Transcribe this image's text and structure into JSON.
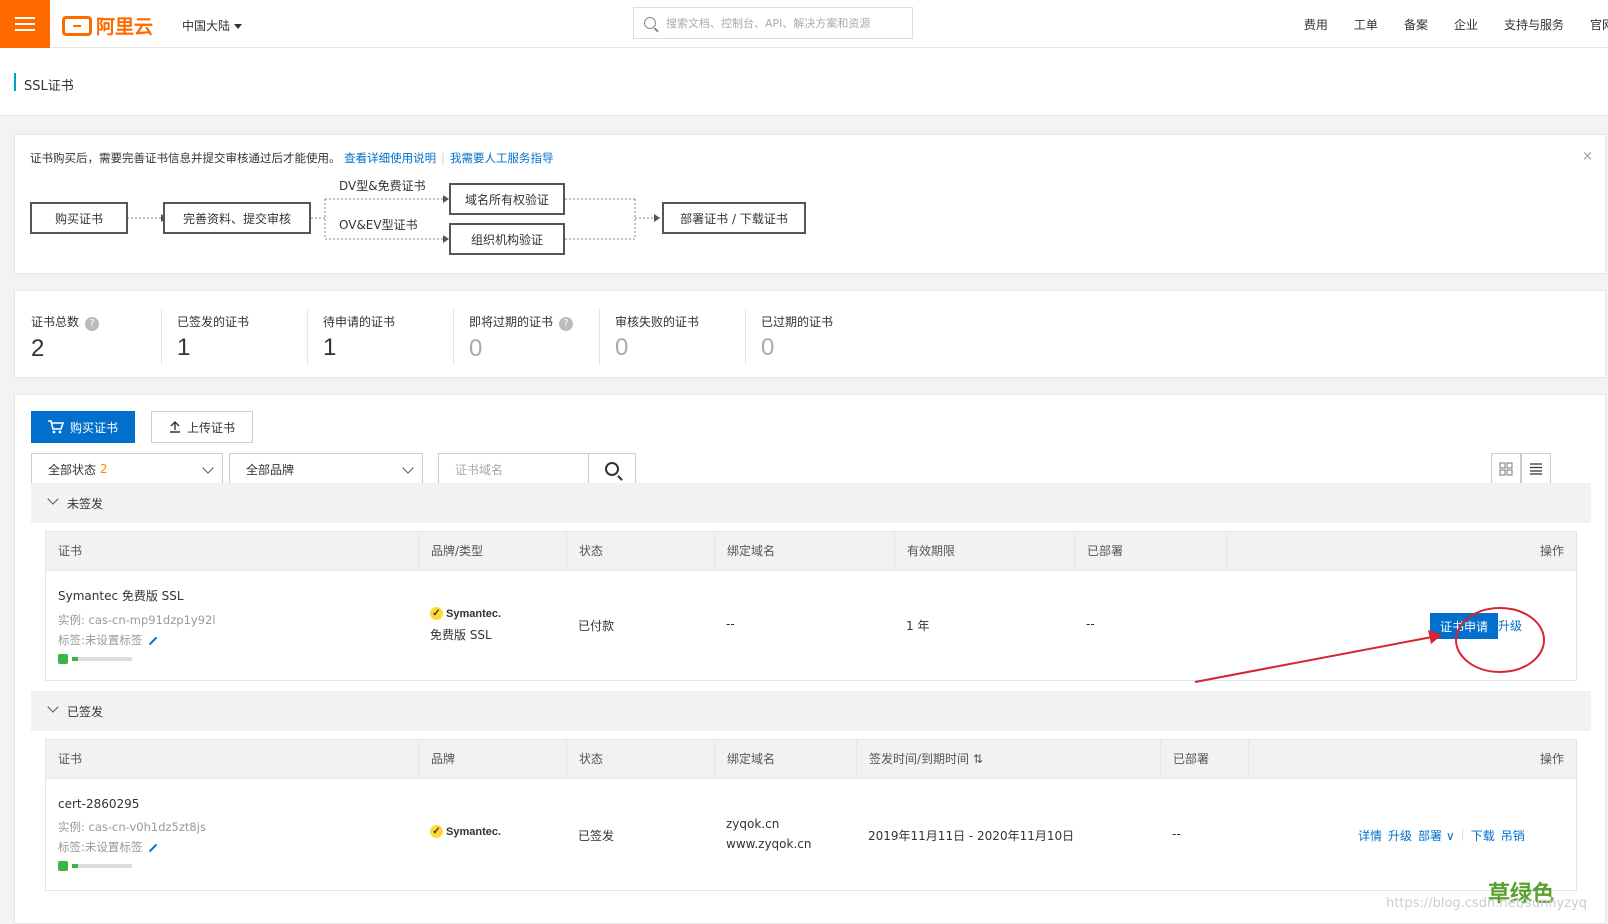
{
  "header": {
    "logo_text": "阿里云",
    "region": "中国大陆",
    "search_placeholder": "搜索文档、控制台、API、解决方案和资源",
    "nav": [
      "费用",
      "工单",
      "备案",
      "企业",
      "支持与服务",
      "官网"
    ],
    "accent": "#ff6a00"
  },
  "page": {
    "title": "SSL证书"
  },
  "notice": {
    "text": "证书购买后，需要完善证书信息并提交审核通过后才能使用。",
    "link1": "查看详细使用说明",
    "link2": "我需要人工服务指导",
    "close": "×",
    "flow": {
      "step_buy": "购买证书",
      "step_submit": "完善资料、提交审核",
      "branch_dv": "DV型&免费证书",
      "branch_ov": "OV&EV型证书",
      "step_domain": "域名所有权验证",
      "step_org": "组织机构验证",
      "step_deploy": "部署证书 / 下载证书"
    }
  },
  "stats": [
    {
      "label": "证书总数",
      "value": "2",
      "help": true
    },
    {
      "label": "已签发的证书",
      "value": "1",
      "help": false
    },
    {
      "label": "待申请的证书",
      "value": "1",
      "help": false
    },
    {
      "label": "即将过期的证书",
      "value": "0",
      "help": true
    },
    {
      "label": "审核失败的证书",
      "value": "0",
      "help": false
    },
    {
      "label": "已过期的证书",
      "value": "0",
      "help": false
    }
  ],
  "toolbar": {
    "buy_label": "购买证书",
    "upload_label": "上传证书",
    "status_filter": "全部状态",
    "status_count": "2",
    "brand_filter": "全部品牌",
    "domain_placeholder": "证书域名"
  },
  "unissued": {
    "group_label": "未签发",
    "columns": [
      "证书",
      "品牌/类型",
      "状态",
      "绑定域名",
      "有效期限",
      "已部署",
      "操作"
    ],
    "row": {
      "name": "Symantec 免费版 SSL",
      "instance": "实例: cas-cn-mp91dzp1y92l",
      "tag": "标签:未设置标签",
      "brand": "Symantec.",
      "type": "免费版 SSL",
      "status": "已付款",
      "domain": "--",
      "validity": "1 年",
      "deployed": "--",
      "action_primary": "证书申请",
      "action_upgrade": "升级"
    }
  },
  "issued": {
    "group_label": "已签发",
    "columns": [
      "证书",
      "品牌",
      "状态",
      "绑定域名",
      "签发时间/到期时间",
      "已部署",
      "操作"
    ],
    "row": {
      "name": "cert-2860295",
      "instance": "实例: cas-cn-v0h1dz5zt8js",
      "tag": "标签:未设置标签",
      "brand": "Symantec.",
      "status": "已签发",
      "domain1": "zyqok.cn",
      "domain2": "www.zyqok.cn",
      "dates": "2019年11月11日 - 2020年11月10日",
      "deployed": "--",
      "actions": [
        "详情",
        "升级",
        "部署",
        "下载",
        "吊销"
      ]
    }
  },
  "watermark": {
    "green": "草绿色",
    "url": "https://blog.csdn.net/sunnyzyq"
  }
}
